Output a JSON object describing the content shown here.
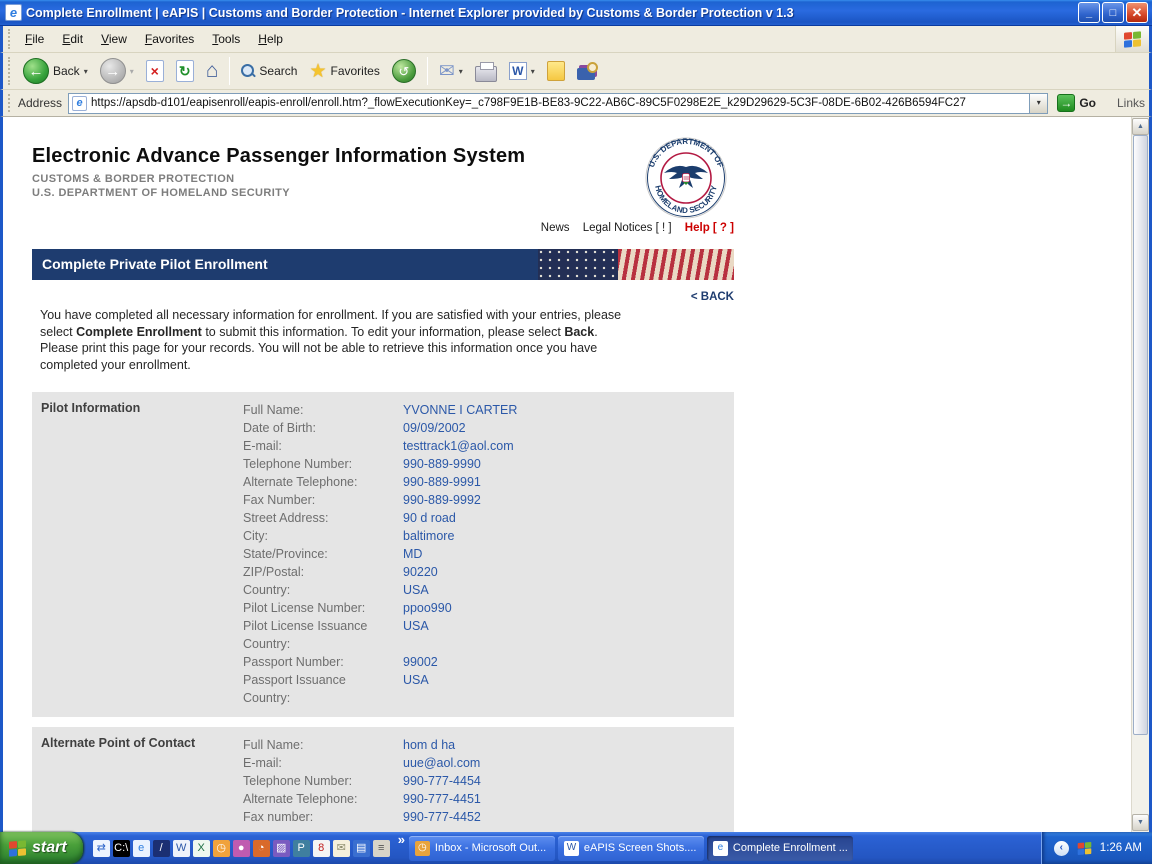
{
  "window": {
    "title": "Complete Enrollment | eAPIS | Customs and Border Protection - Internet Explorer provided by Customs & Border Protection v 1.3"
  },
  "menu": {
    "items": [
      "File",
      "Edit",
      "View",
      "Favorites",
      "Tools",
      "Help"
    ]
  },
  "toolbar": {
    "back": "Back",
    "search": "Search",
    "favorites": "Favorites"
  },
  "address": {
    "label": "Address",
    "url": "https://apsdb-d101/eapisenroll/eapis-enroll/enroll.htm?_flowExecutionKey=_c798F9E1B-BE83-9C22-AB6C-89C5F0298E2E_k29D29629-5C3F-08DE-6B02-426B6594FC27",
    "go": "Go",
    "links": "Links"
  },
  "icons": {
    "back-arrow": "←",
    "forward-arrow": "→",
    "stop": "×",
    "refresh": "↻",
    "home": "⌂",
    "history": "↺",
    "mail": "✉",
    "favorites-star": "★",
    "dropdown": "▾",
    "go-arrow": "→",
    "scroll-up": "▲",
    "scroll-down": "▼",
    "overflow": "»",
    "tray-chevron": "‹",
    "ie": "e",
    "word": "W"
  },
  "page": {
    "app_title": "Electronic Advance Passenger Information System",
    "org_line1": "CUSTOMS & BORDER PROTECTION",
    "org_line2": "U.S. DEPARTMENT OF HOMELAND SECURITY",
    "seal_top": "U.S. DEPARTMENT OF",
    "seal_bottom": "HOMELAND SECURITY",
    "links": {
      "news": "News",
      "legal_notices": "Legal Notices [ ! ]",
      "help": "Help [ ? ]"
    },
    "banner_title": "Complete Private Pilot Enrollment",
    "back_link": "< BACK",
    "intro": {
      "p1": "You have completed all necessary information for enrollment. If you are satisfied with your entries, please select ",
      "b1": "Complete Enrollment",
      "p2": " to submit this information. To edit your information, please select ",
      "b2": "Back",
      "p3": ". Please print this page for your records. You will not be able to retrieve this information once you have completed your enrollment."
    },
    "sections": [
      {
        "title": "Pilot Information",
        "rows": [
          {
            "label": "Full Name:",
            "value": "YVONNE I CARTER"
          },
          {
            "label": "Date of Birth:",
            "value": "09/09/2002"
          },
          {
            "label": "E-mail:",
            "value": "testtrack1@aol.com"
          },
          {
            "label": "Telephone Number:",
            "value": "990-889-9990"
          },
          {
            "label": "Alternate Telephone:",
            "value": "990-889-9991"
          },
          {
            "label": "Fax Number:",
            "value": "990-889-9992"
          },
          {
            "label": "Street Address:",
            "value": "90 d road"
          },
          {
            "label": "City:",
            "value": "baltimore"
          },
          {
            "label": "State/Province:",
            "value": "MD"
          },
          {
            "label": "ZIP/Postal:",
            "value": "90220"
          },
          {
            "label": "Country:",
            "value": "USA"
          },
          {
            "label": "Pilot License Number:",
            "value": "ppoo990"
          },
          {
            "label": "Pilot License Issuance Country:",
            "value": "USA"
          },
          {
            "label": "Passport Number:",
            "value": "99002"
          },
          {
            "label": "Passport Issuance Country:",
            "value": "USA"
          }
        ]
      },
      {
        "title": "Alternate Point of Contact",
        "rows": [
          {
            "label": "Full Name:",
            "value": "hom d ha"
          },
          {
            "label": "E-mail:",
            "value": "uue@aol.com"
          },
          {
            "label": "Telephone Number:",
            "value": "990-777-4454"
          },
          {
            "label": "Alternate Telephone:",
            "value": "990-777-4451"
          },
          {
            "label": "Fax number:",
            "value": "990-777-4452"
          }
        ]
      }
    ]
  },
  "taskbar": {
    "start_label": "start",
    "quicklaunch": [
      {
        "name": "sync-icon",
        "glyph": "⇄",
        "bg": "#eef4ff",
        "fg": "#2a62c9"
      },
      {
        "name": "command-prompt-icon",
        "glyph": "C:\\",
        "bg": "#000000",
        "fg": "#ffffff"
      },
      {
        "name": "internet-explorer-icon",
        "glyph": "e",
        "bg": "#eaf2ff",
        "fg": "#2f7ee0"
      },
      {
        "name": "pen-icon",
        "glyph": "/",
        "bg": "#1b2f73",
        "fg": "#ffffff"
      },
      {
        "name": "word-icon",
        "glyph": "W",
        "bg": "#eef2fb",
        "fg": "#2b57a8"
      },
      {
        "name": "excel-icon",
        "glyph": "X",
        "bg": "#eef8ef",
        "fg": "#1e7145"
      },
      {
        "name": "outlook-clock-icon",
        "glyph": "◷",
        "bg": "#f0a23c",
        "fg": "#ffffff"
      },
      {
        "name": "key-icon",
        "glyph": "●",
        "bg": "#c05bb0",
        "fg": "#ffffff"
      },
      {
        "name": "timer-icon",
        "glyph": "◔",
        "bg": "#d96a2b",
        "fg": "#ffffff"
      },
      {
        "name": "photo-icon",
        "glyph": "▨",
        "bg": "#7a5bc0",
        "fg": "#ffffff"
      },
      {
        "name": "publisher-icon",
        "glyph": "P",
        "bg": "#3f7f9f",
        "fg": "#ffffff"
      },
      {
        "name": "diamond-8-icon",
        "glyph": "8",
        "bg": "#f4f4f4",
        "fg": "#c02020"
      },
      {
        "name": "stationery-icon",
        "glyph": "✉",
        "bg": "#f5f0dc",
        "fg": "#8a8a6a"
      },
      {
        "name": "book-icon",
        "glyph": "▤",
        "bg": "#3a6fd0",
        "fg": "#ffffff"
      },
      {
        "name": "fax-icon",
        "glyph": "≡",
        "bg": "#d8d4c8",
        "fg": "#555555"
      }
    ],
    "overflow": "»",
    "buttons": [
      {
        "label": "Inbox - Microsoft Out...",
        "icon": "outlook",
        "glyph": "◷",
        "bg": "#e8a33d",
        "fg": "#ffffff",
        "active": false
      },
      {
        "label": "eAPIS Screen Shots....",
        "icon": "word",
        "glyph": "W",
        "bg": "#ffffff",
        "fg": "#2b57a8",
        "active": false
      },
      {
        "label": "Complete Enrollment ...",
        "icon": "internet-explorer",
        "glyph": "e",
        "bg": "#ffffff",
        "fg": "#2f7ee0",
        "active": true
      }
    ],
    "tray": {
      "time": "1:26 AM"
    }
  },
  "colors": {
    "banner_navy": "#1e3c6f",
    "value_blue": "#2b58a8",
    "label_gray": "#6e6e6e",
    "help_red": "#cc0000",
    "section_bg": "#e5e5e5",
    "titlebar_blue": "#2a6be0",
    "taskbar_blue": "#2456c2",
    "start_green": "#4aa03a"
  }
}
